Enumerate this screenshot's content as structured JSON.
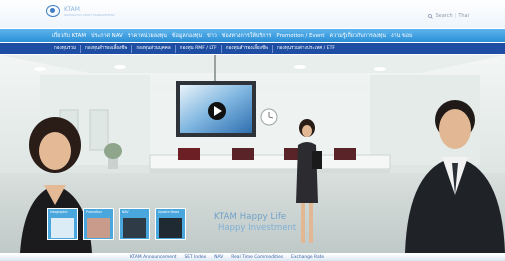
{
  "header": {
    "logo_name": "KTAM",
    "logo_sub": "KRUNGTHAI ASSET MANAGEMENT",
    "search_label": "Search",
    "search_sep": "|",
    "lang_label": "Thai"
  },
  "nav_primary": [
    "เกี่ยวกับ KTAM",
    "ประกาศ NAV",
    "ราคาหน่วยลงทุน",
    "ข้อมูลกองทุน",
    "ข่าว",
    "ช่องทางการให้บริการ",
    "Promotion / Event",
    "ความรู้เกี่ยวกับการลงทุน",
    "งาน ขอบ"
  ],
  "nav_secondary": [
    "กองทุนรวม",
    "กองทุนสำรองเลี้ยงชีพ",
    "กองทุนส่วนบุคคล",
    "กองทุน RMF / LTF",
    "กองทุนสำรองเลี้ยงชีพ",
    "กองทุนรวมต่างประเทศ / ETF"
  ],
  "hero": {
    "tagline_1": "KTAM Happy Life",
    "tagline_2": "Happy Investment",
    "tiles": [
      "Infographic",
      "Promotion",
      "NAV",
      "Update News"
    ]
  },
  "bottom_bar": [
    "KTAM Announcement",
    "SET Index",
    "NAV",
    "Real Time Commodities",
    "Exchange Rate"
  ],
  "colors": {
    "nav_primary_bg": "#2b8fd6",
    "nav_secondary_bg": "#1d4ea3",
    "tagline": "#6f9fc8"
  }
}
